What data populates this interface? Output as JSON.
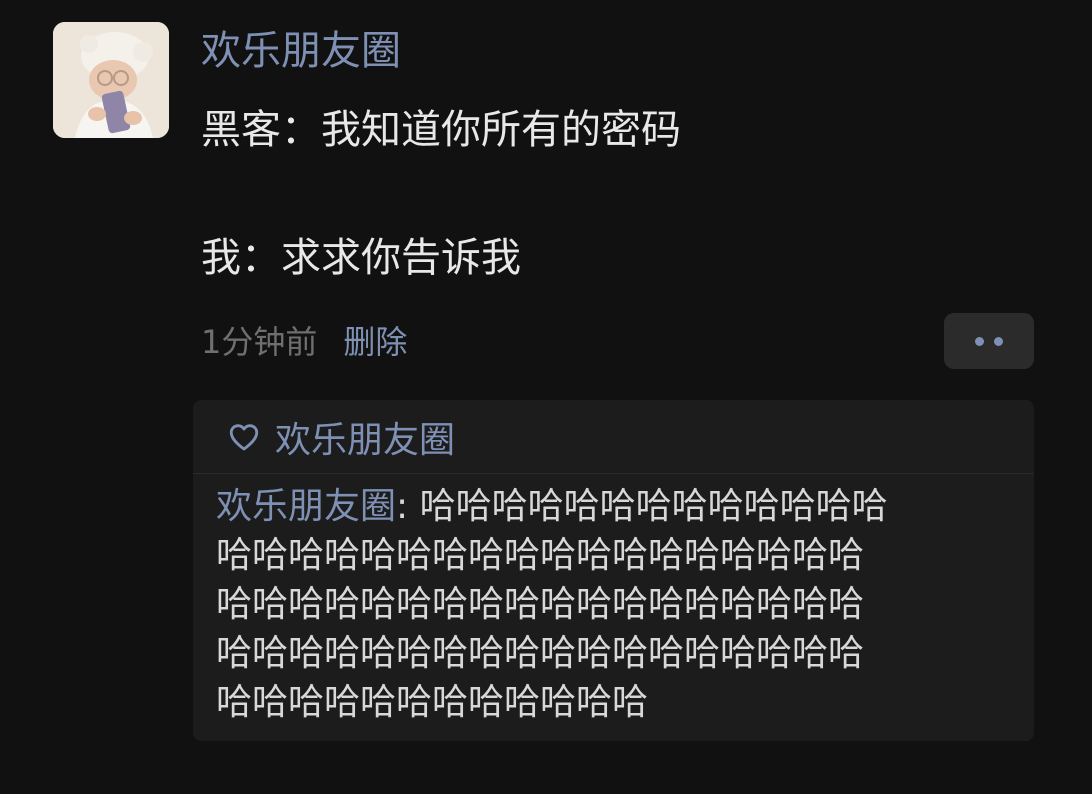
{
  "post": {
    "author": "欢乐朋友圈",
    "lines": [
      "黑客：我知道你所有的密码",
      "",
      "我：求求你告诉我"
    ],
    "time": "1分钟前",
    "delete_label": "删除"
  },
  "more_button": {
    "icon": "more-dots-icon"
  },
  "interactions": {
    "like_icon": "heart-outline-icon",
    "likers": "欢乐朋友圈",
    "comment": {
      "author": "欢乐朋友圈",
      "separator": ": ",
      "lines": [
        "哈哈哈哈哈哈哈哈哈哈哈哈哈",
        "哈哈哈哈哈哈哈哈哈哈哈哈哈哈哈哈哈哈",
        "哈哈哈哈哈哈哈哈哈哈哈哈哈哈哈哈哈哈",
        "哈哈哈哈哈哈哈哈哈哈哈哈哈哈哈哈哈哈",
        "哈哈哈哈哈哈哈哈哈哈哈哈"
      ]
    }
  },
  "colors": {
    "background": "#111111",
    "link": "#7e90b3",
    "panel": "#1c1c1c",
    "text": "#e8e8e8",
    "muted": "#6f6f6f"
  }
}
